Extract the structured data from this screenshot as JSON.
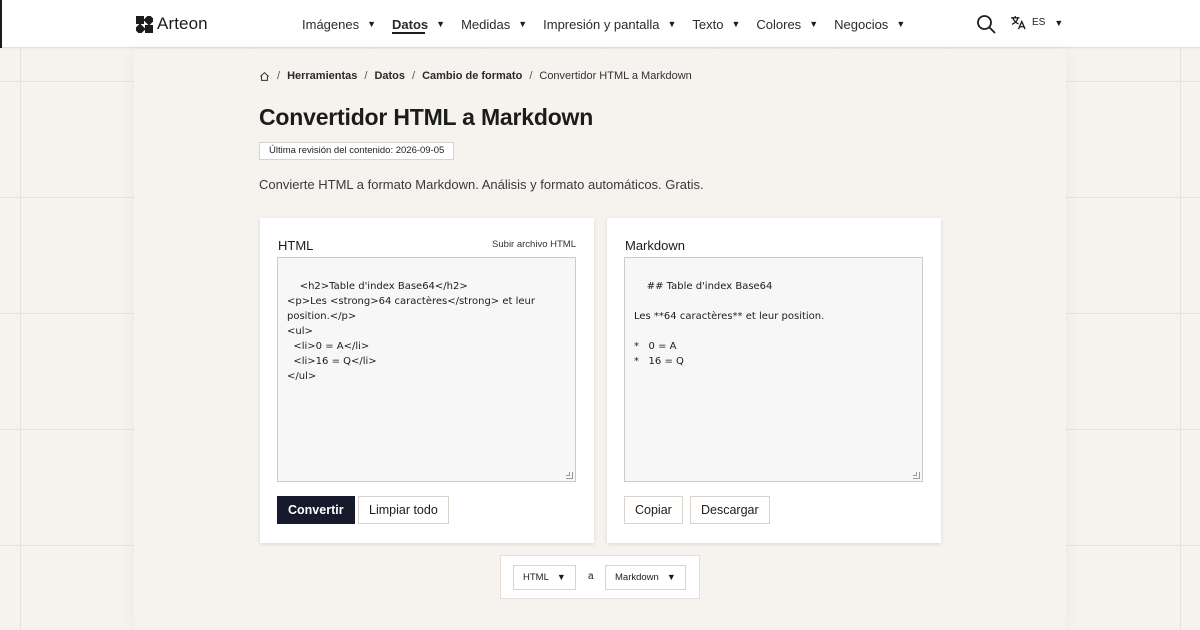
{
  "header": {
    "logo_text": "Arteon",
    "nav": [
      {
        "label": "Imágenes",
        "active": false
      },
      {
        "label": "Datos",
        "active": true
      },
      {
        "label": "Medidas",
        "active": false
      },
      {
        "label": "Impresión y pantalla",
        "active": false
      },
      {
        "label": "Texto",
        "active": false
      },
      {
        "label": "Colores",
        "active": false
      },
      {
        "label": "Negocios",
        "active": false
      }
    ],
    "lang_code": "ES"
  },
  "breadcrumb": {
    "items": [
      "Herramientas",
      "Datos",
      "Cambio de formato"
    ],
    "current": "Convertidor HTML a Markdown"
  },
  "page": {
    "title": "Convertidor HTML a Markdown",
    "revision": "Última revisión del contenido: 2026-09-05",
    "subtitle": "Convierte HTML a formato Markdown. Análisis y formato automáticos. Gratis."
  },
  "input_card": {
    "label": "HTML",
    "upload_link": "Subir archivo HTML",
    "content": "<h2>Table d'index Base64</h2>\n<p>Les <strong>64 caractères</strong> et leur position.</p>\n<ul>\n  <li>0 = A</li>\n  <li>16 = Q</li>\n</ul>",
    "convert_label": "Convertir",
    "clear_label": "Limpiar todo"
  },
  "output_card": {
    "label": "Markdown",
    "content": "## Table d'index Base64\n\nLes **64 caractères** et leur position.\n\n*   0 = A\n*   16 = Q",
    "copy_label": "Copiar",
    "download_label": "Descargar"
  },
  "format_bar": {
    "from": "HTML",
    "connector": "a",
    "to": "Markdown"
  }
}
